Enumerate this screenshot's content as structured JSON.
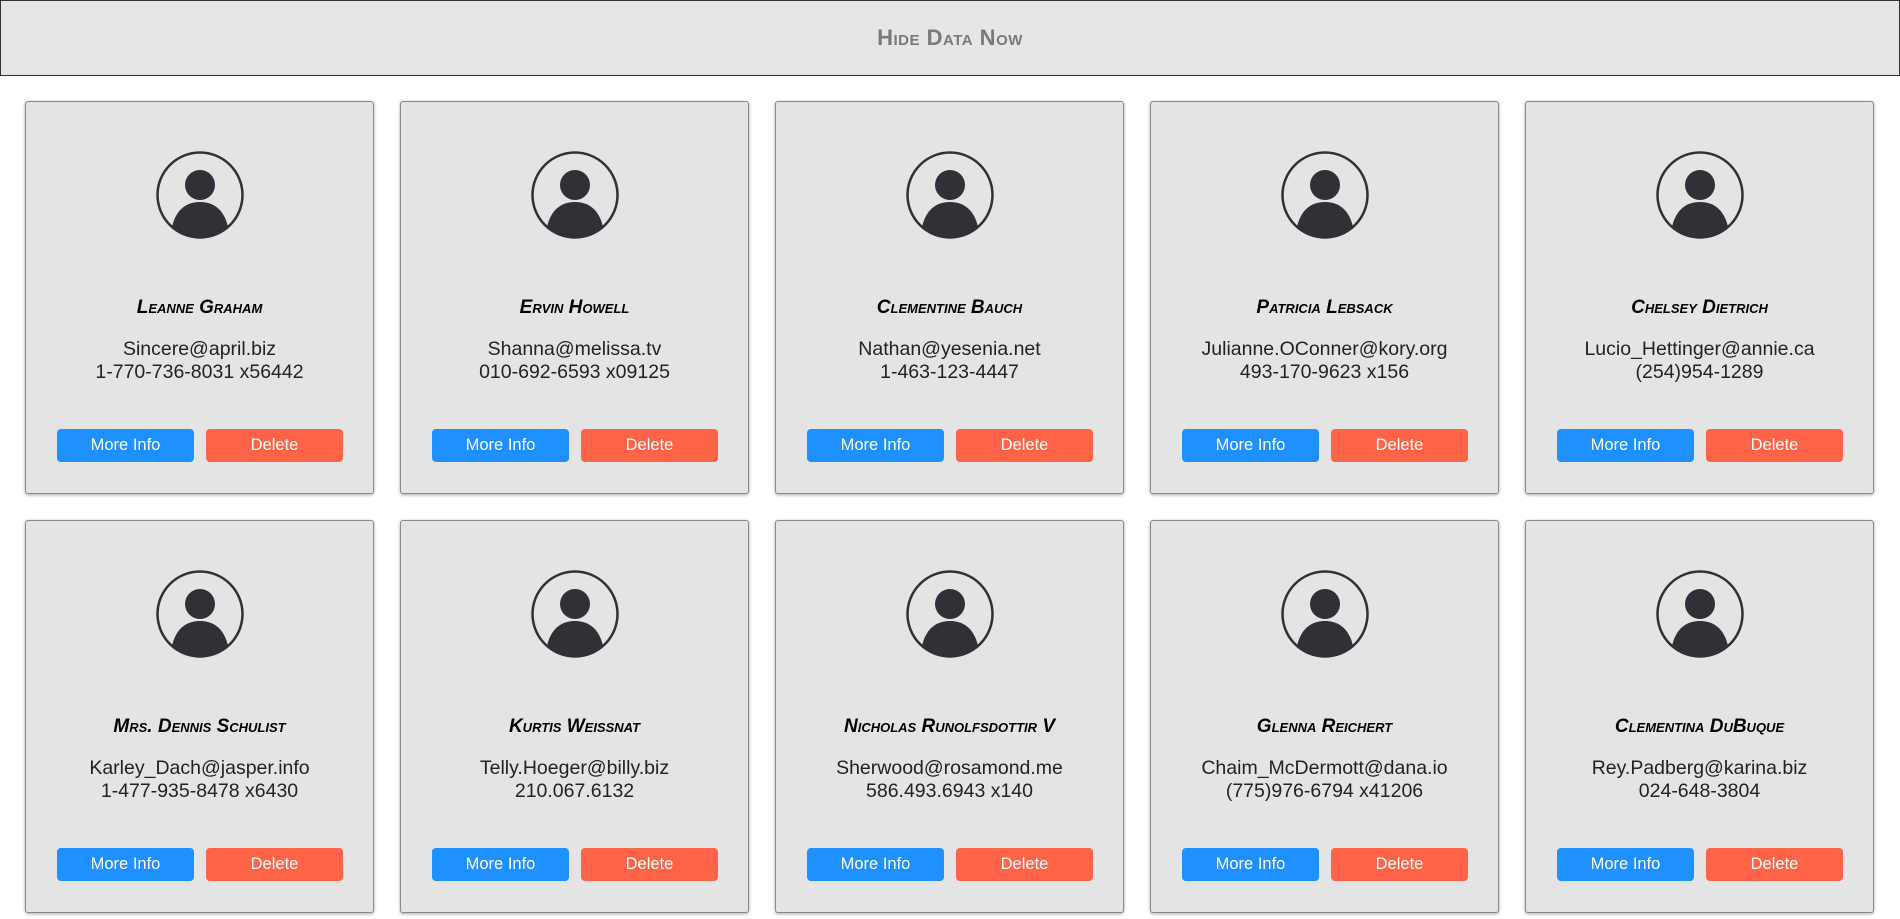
{
  "toggle": {
    "label": "Hide Data Now"
  },
  "colors": {
    "more_info": "#1e90ff",
    "delete": "#ff6347",
    "card_bg": "#e4e4e4",
    "avatar": "#2f3136"
  },
  "icons": {
    "avatar": "user-avatar-icon"
  },
  "users": [
    {
      "name": "Leanne Graham",
      "email": "Sincere@april.biz",
      "phone": "1-770-736-8031 x56442",
      "more_label": "More Info",
      "delete_label": "Delete"
    },
    {
      "name": "Ervin Howell",
      "email": "Shanna@melissa.tv",
      "phone": "010-692-6593 x09125",
      "more_label": "More Info",
      "delete_label": "Delete"
    },
    {
      "name": "Clementine Bauch",
      "email": "Nathan@yesenia.net",
      "phone": "1-463-123-4447",
      "more_label": "More Info",
      "delete_label": "Delete"
    },
    {
      "name": "Patricia Lebsack",
      "email": "Julianne.OConner@kory.org",
      "phone": "493-170-9623 x156",
      "more_label": "More Info",
      "delete_label": "Delete"
    },
    {
      "name": "Chelsey Dietrich",
      "email": "Lucio_Hettinger@annie.ca",
      "phone": "(254)954-1289",
      "more_label": "More Info",
      "delete_label": "Delete"
    },
    {
      "name": "Mrs. Dennis Schulist",
      "email": "Karley_Dach@jasper.info",
      "phone": "1-477-935-8478 x6430",
      "more_label": "More Info",
      "delete_label": "Delete"
    },
    {
      "name": "Kurtis Weissnat",
      "email": "Telly.Hoeger@billy.biz",
      "phone": "210.067.6132",
      "more_label": "More Info",
      "delete_label": "Delete"
    },
    {
      "name": "Nicholas Runolfsdottir V",
      "email": "Sherwood@rosamond.me",
      "phone": "586.493.6943 x140",
      "more_label": "More Info",
      "delete_label": "Delete"
    },
    {
      "name": "Glenna Reichert",
      "email": "Chaim_McDermott@dana.io",
      "phone": "(775)976-6794 x41206",
      "more_label": "More Info",
      "delete_label": "Delete"
    },
    {
      "name": "Clementina DuBuque",
      "email": "Rey.Padberg@karina.biz",
      "phone": "024-648-3804",
      "more_label": "More Info",
      "delete_label": "Delete"
    }
  ]
}
